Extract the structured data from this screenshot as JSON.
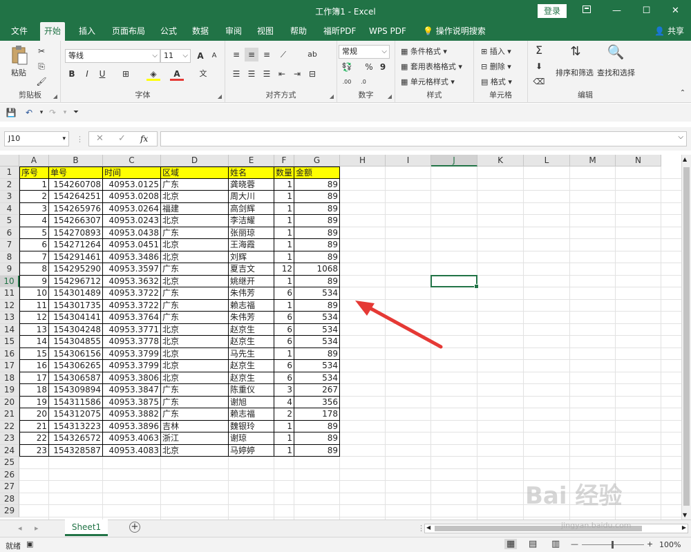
{
  "titlebar": {
    "title": "工作簿1  -  Excel",
    "login": "登录",
    "ribbon_display_icon": "ribbon-display-icon",
    "minimize": "—",
    "maximize": "☐",
    "close": "✕"
  },
  "tabs": [
    "文件",
    "开始",
    "插入",
    "页面布局",
    "公式",
    "数据",
    "审阅",
    "视图",
    "帮助",
    "福昕PDF",
    "WPS PDF",
    "操作说明搜索"
  ],
  "active_tab": "开始",
  "share": "共享",
  "ribbon": {
    "clipboard": {
      "label": "剪贴板",
      "paste": "粘贴"
    },
    "font": {
      "label": "字体",
      "font_name": "等线",
      "font_size": "11",
      "bold": "B",
      "italic": "I",
      "underline": "U",
      "grow": "A",
      "shrink": "A",
      "font_color": "A",
      "phonetic": "文"
    },
    "alignment": {
      "label": "对齐方式",
      "wrap_icon": "ab"
    },
    "number": {
      "label": "数字",
      "format": "常规",
      "percent": "%",
      "comma": "9",
      "inc": ".00",
      "dec": ".0"
    },
    "styles": {
      "label": "样式",
      "cond": "条件格式",
      "table": "套用表格格式",
      "cell": "单元格样式"
    },
    "cells": {
      "label": "单元格",
      "insert": "插入",
      "delete": "删除",
      "format": "格式"
    },
    "editing": {
      "label": "编辑",
      "sort": "排序和筛选",
      "find": "查找和选择"
    }
  },
  "formula_bar": {
    "name_box": "J10",
    "fx": "fx",
    "cancel": "✕",
    "enter": "✓",
    "value": ""
  },
  "columns": [
    "A",
    "B",
    "C",
    "D",
    "E",
    "F",
    "G",
    "H",
    "I",
    "J",
    "K",
    "L",
    "M",
    "N"
  ],
  "selected_column": "J",
  "selected_row": "10",
  "table": {
    "headers": [
      "序号",
      "单号",
      "时间",
      "区域",
      "姓名",
      "数量",
      "金额"
    ],
    "rows": [
      [
        "1",
        "154260708",
        "40953.0125",
        "广东",
        "龚晓蓉",
        "1",
        "89"
      ],
      [
        "2",
        "154264251",
        "40953.0208",
        "北京",
        "周大川",
        "1",
        "89"
      ],
      [
        "3",
        "154265976",
        "40953.0264",
        "福建",
        "高剑辉",
        "1",
        "89"
      ],
      [
        "4",
        "154266307",
        "40953.0243",
        "北京",
        "李洁耀",
        "1",
        "89"
      ],
      [
        "5",
        "154270893",
        "40953.0438",
        "广东",
        "张丽琼",
        "1",
        "89"
      ],
      [
        "6",
        "154271264",
        "40953.0451",
        "北京",
        "王海霞",
        "1",
        "89"
      ],
      [
        "7",
        "154291461",
        "40953.3486",
        "北京",
        "刘辉",
        "1",
        "89"
      ],
      [
        "8",
        "154295290",
        "40953.3597",
        "广东",
        "夏吉文",
        "12",
        "1068"
      ],
      [
        "9",
        "154296712",
        "40953.3632",
        "北京",
        "姚继开",
        "1",
        "89"
      ],
      [
        "10",
        "154301489",
        "40953.3722",
        "广东",
        "朱伟芳",
        "6",
        "534"
      ],
      [
        "11",
        "154301735",
        "40953.3722",
        "广东",
        "赖志福",
        "1",
        "89"
      ],
      [
        "12",
        "154304141",
        "40953.3764",
        "广东",
        "朱伟芳",
        "6",
        "534"
      ],
      [
        "13",
        "154304248",
        "40953.3771",
        "北京",
        "赵京生",
        "6",
        "534"
      ],
      [
        "14",
        "154304855",
        "40953.3778",
        "北京",
        "赵京生",
        "6",
        "534"
      ],
      [
        "15",
        "154306156",
        "40953.3799",
        "北京",
        "马先生",
        "1",
        "89"
      ],
      [
        "16",
        "154306265",
        "40953.3799",
        "北京",
        "赵京生",
        "6",
        "534"
      ],
      [
        "17",
        "154306587",
        "40953.3806",
        "北京",
        "赵京生",
        "6",
        "534"
      ],
      [
        "18",
        "154309894",
        "40953.3847",
        "广东",
        "陈重仪",
        "3",
        "267"
      ],
      [
        "19",
        "154311586",
        "40953.3875",
        "广东",
        "谢旭",
        "4",
        "356"
      ],
      [
        "20",
        "154312075",
        "40953.3882",
        "广东",
        "赖志福",
        "2",
        "178"
      ],
      [
        "21",
        "154313223",
        "40953.3896",
        "吉林",
        "魏银玲",
        "1",
        "89"
      ],
      [
        "22",
        "154326572",
        "40953.4063",
        "浙江",
        "谢琼",
        "1",
        "89"
      ],
      [
        "23",
        "154328587",
        "40953.4083",
        "北京",
        "马婷婷",
        "1",
        "89"
      ]
    ]
  },
  "row_numbers": [
    "1",
    "2",
    "3",
    "4",
    "5",
    "6",
    "7",
    "8",
    "9",
    "10",
    "11",
    "12",
    "13",
    "14",
    "15",
    "16",
    "17",
    "18",
    "19",
    "20",
    "21",
    "22",
    "23",
    "24",
    "25",
    "26",
    "27",
    "28",
    "29"
  ],
  "sheet_tab": "Sheet1",
  "add_sheet": "+",
  "status": {
    "ready": "就绪",
    "zoom": "100%",
    "zoom_minus": "—",
    "zoom_plus": "+"
  },
  "colors": {
    "accent": "#217346",
    "header_fill": "#ffff00",
    "arrow": "#e53935"
  },
  "watermark": {
    "main": "Bai 经验",
    "sub": "jingyan.baidu.com"
  }
}
